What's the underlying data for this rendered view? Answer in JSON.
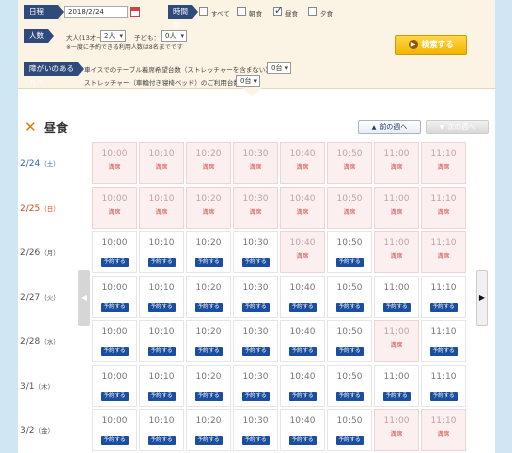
{
  "search": {
    "date_tag": "日程",
    "date_value": "2018/2/24",
    "time_tag": "時間帯",
    "time_options": [
      {
        "label": "すべて",
        "checked": false
      },
      {
        "label": "朝食",
        "checked": false
      },
      {
        "label": "昼食",
        "checked": true
      },
      {
        "label": "夕食",
        "checked": false
      }
    ],
    "people_tag": "人数",
    "adult_label": "大人(13才〜)：",
    "adult_value": "2人",
    "child_label": "子ども：",
    "child_value": "0人",
    "people_note": "※一度に予約できる利用人数は8名までです",
    "disability_tag": "障がいのある方へ",
    "wheelchair_label": "車イスでのテーブル着席希望台数（ストレッチャーを含まない）：",
    "wheelchair_value": "0台",
    "stretcher_label": "ストレッチャー（車輪付き寝椅ベッド）のご利用台数：",
    "stretcher_value": "0台",
    "search_button": "検索する"
  },
  "section": {
    "title": "昼食",
    "prev_week": "前の週へ",
    "next_week": "次の週へ"
  },
  "status_full": "満席",
  "reserve_label": "予約する",
  "days": [
    {
      "date": "2/24",
      "weekday": "（土）",
      "color": "#2f63b5",
      "slots": [
        [
          "10:00",
          "full"
        ],
        [
          "10:10",
          "full"
        ],
        [
          "10:20",
          "full"
        ],
        [
          "10:30",
          "full"
        ],
        [
          "10:40",
          "full"
        ],
        [
          "10:50",
          "full"
        ],
        [
          "11:00",
          "full"
        ],
        [
          "11:10",
          "full"
        ]
      ]
    },
    {
      "date": "2/25",
      "weekday": "（日）",
      "color": "#d0491c",
      "slots": [
        [
          "10:00",
          "full"
        ],
        [
          "10:10",
          "full"
        ],
        [
          "10:20",
          "full"
        ],
        [
          "10:30",
          "full"
        ],
        [
          "10:40",
          "full"
        ],
        [
          "10:50",
          "full"
        ],
        [
          "11:00",
          "full"
        ],
        [
          "11:10",
          "full"
        ]
      ]
    },
    {
      "date": "2/26",
      "weekday": "（月）",
      "color": "#555555",
      "slots": [
        [
          "10:00",
          "open"
        ],
        [
          "10:10",
          "open"
        ],
        [
          "10:20",
          "open"
        ],
        [
          "10:30",
          "open"
        ],
        [
          "10:40",
          "full"
        ],
        [
          "10:50",
          "open"
        ],
        [
          "11:00",
          "full"
        ],
        [
          "11:10",
          "full"
        ]
      ]
    },
    {
      "date": "2/27",
      "weekday": "（火）",
      "color": "#555555",
      "slots": [
        [
          "10:00",
          "open"
        ],
        [
          "10:10",
          "open"
        ],
        [
          "10:20",
          "open"
        ],
        [
          "10:30",
          "open"
        ],
        [
          "10:40",
          "open"
        ],
        [
          "10:50",
          "open"
        ],
        [
          "11:00",
          "open"
        ],
        [
          "11:10",
          "open"
        ]
      ]
    },
    {
      "date": "2/28",
      "weekday": "（水）",
      "color": "#555555",
      "slots": [
        [
          "10:00",
          "open"
        ],
        [
          "10:10",
          "open"
        ],
        [
          "10:20",
          "open"
        ],
        [
          "10:30",
          "open"
        ],
        [
          "10:40",
          "open"
        ],
        [
          "10:50",
          "open"
        ],
        [
          "11:00",
          "full"
        ],
        [
          "11:10",
          "open"
        ]
      ]
    },
    {
      "date": "3/1",
      "weekday": "（木）",
      "color": "#555555",
      "slots": [
        [
          "10:00",
          "open"
        ],
        [
          "10:10",
          "open"
        ],
        [
          "10:20",
          "open"
        ],
        [
          "10:30",
          "open"
        ],
        [
          "10:40",
          "open"
        ],
        [
          "10:50",
          "open"
        ],
        [
          "11:00",
          "open"
        ],
        [
          "11:10",
          "open"
        ]
      ]
    },
    {
      "date": "3/2",
      "weekday": "（金）",
      "color": "#555555",
      "slots": [
        [
          "10:00",
          "open"
        ],
        [
          "10:10",
          "open"
        ],
        [
          "10:20",
          "open"
        ],
        [
          "10:30",
          "open"
        ],
        [
          "10:40",
          "open"
        ],
        [
          "10:50",
          "open"
        ],
        [
          "11:00",
          "full"
        ],
        [
          "11:10",
          "full"
        ]
      ]
    }
  ]
}
